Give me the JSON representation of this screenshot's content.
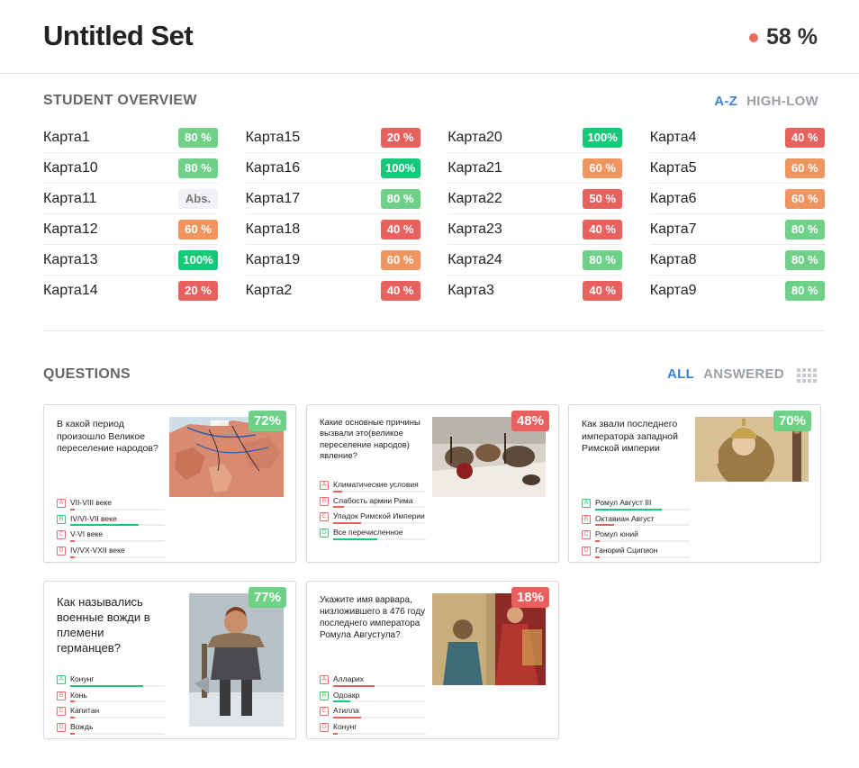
{
  "header": {
    "title": "Untitled Set",
    "overall_score": "58 %",
    "score_color": "#e96a5f"
  },
  "overview": {
    "title": "STUDENT OVERVIEW",
    "sort_az": "A-Z",
    "sort_high_low": "HIGH-LOW"
  },
  "colors": {
    "green": "#6fd088",
    "bright_green": "#16c97a",
    "orange": "#f0955f",
    "red": "#e9615f",
    "abs": "#f1f2f6"
  },
  "students": [
    [
      {
        "name": "Карта1",
        "score": "80 %",
        "color": "#6fd088"
      },
      {
        "name": "Карта10",
        "score": "80 %",
        "color": "#6fd088"
      },
      {
        "name": "Карта11",
        "score": "Abs.",
        "color": "abs"
      },
      {
        "name": "Карта12",
        "score": "60 %",
        "color": "#f0955f"
      },
      {
        "name": "Карта13",
        "score": "100%",
        "color": "#16c97a"
      },
      {
        "name": "Карта14",
        "score": "20 %",
        "color": "#e9615f"
      }
    ],
    [
      {
        "name": "Карта15",
        "score": "20 %",
        "color": "#e9615f"
      },
      {
        "name": "Карта16",
        "score": "100%",
        "color": "#16c97a"
      },
      {
        "name": "Карта17",
        "score": "80 %",
        "color": "#6fd088"
      },
      {
        "name": "Карта18",
        "score": "40 %",
        "color": "#e9615f"
      },
      {
        "name": "Карта19",
        "score": "60 %",
        "color": "#f0955f"
      },
      {
        "name": "Карта2",
        "score": "40 %",
        "color": "#e9615f"
      }
    ],
    [
      {
        "name": "Карта20",
        "score": "100%",
        "color": "#16c97a"
      },
      {
        "name": "Карта21",
        "score": "60 %",
        "color": "#f0955f"
      },
      {
        "name": "Карта22",
        "score": "50 %",
        "color": "#e9615f"
      },
      {
        "name": "Карта23",
        "score": "40 %",
        "color": "#e9615f"
      },
      {
        "name": "Карта24",
        "score": "80 %",
        "color": "#6fd088"
      },
      {
        "name": "Карта3",
        "score": "40 %",
        "color": "#e9615f"
      }
    ],
    [
      {
        "name": "Карта4",
        "score": "40 %",
        "color": "#e9615f"
      },
      {
        "name": "Карта5",
        "score": "60 %",
        "color": "#f0955f"
      },
      {
        "name": "Карта6",
        "score": "60 %",
        "color": "#f0955f"
      },
      {
        "name": "Карта7",
        "score": "80 %",
        "color": "#6fd088"
      },
      {
        "name": "Карта8",
        "score": "80 %",
        "color": "#6fd088"
      },
      {
        "name": "Карта9",
        "score": "80 %",
        "color": "#6fd088"
      }
    ]
  ],
  "questions_section": {
    "title": "QUESTIONS",
    "filter_all": "ALL",
    "filter_answered": "ANSWERED",
    "view_icon": "grid-view-icon"
  },
  "questions": [
    {
      "text": "В какой период произошло Великое переселение народов?",
      "percent": "72%",
      "percent_color": "#6fd088",
      "image": "europe-migration-map",
      "answers": [
        {
          "letter": "A",
          "text": "VII-VIII веке",
          "correct": false,
          "share": 0.05
        },
        {
          "letter": "B",
          "text": "IV/VI-VII веке",
          "correct": true,
          "share": 0.72
        },
        {
          "letter": "C",
          "text": "V-VI веке",
          "correct": false,
          "share": 0.05
        },
        {
          "letter": "D",
          "text": "IV/VX-VXII веке",
          "correct": false,
          "share": 0.05
        }
      ]
    },
    {
      "text": "Какие основные причины вызвали это(великое переселение народов) явление?",
      "percent": "48%",
      "percent_color": "#e9615f",
      "image": "barbarian-army-painting",
      "answers": [
        {
          "letter": "A",
          "text": "Климатические условия",
          "correct": false,
          "share": 0.1
        },
        {
          "letter": "B",
          "text": "Слабость армии Рима",
          "correct": false,
          "share": 0.12
        },
        {
          "letter": "C",
          "text": "Упадок Римской Империи",
          "correct": false,
          "share": 0.3
        },
        {
          "letter": "D",
          "text": "Все перечисленное",
          "correct": true,
          "share": 0.48
        }
      ]
    },
    {
      "text": "Как звали последнего императора западной Римской империи",
      "percent": "70%",
      "percent_color": "#6fd088",
      "image": "young-emperor-portrait",
      "answers": [
        {
          "letter": "A",
          "text": "Ромул Август III",
          "correct": true,
          "share": 0.7
        },
        {
          "letter": "B",
          "text": "Октавиан Август",
          "correct": false,
          "share": 0.2
        },
        {
          "letter": "C",
          "text": "Ромул юний",
          "correct": false,
          "share": 0.05
        },
        {
          "letter": "D",
          "text": "Ганорий Сципион",
          "correct": false,
          "share": 0.05
        }
      ]
    },
    {
      "text": "Как назывались военные вожди в племени германцев?",
      "percent": "77%",
      "percent_color": "#6fd088",
      "image": "germanic-warrior-art",
      "answers": [
        {
          "letter": "A",
          "text": "Конунг",
          "correct": true,
          "share": 0.77
        },
        {
          "letter": "B",
          "text": "Конь",
          "correct": false,
          "share": 0.05
        },
        {
          "letter": "C",
          "text": "Капитан",
          "correct": false,
          "share": 0.05
        },
        {
          "letter": "D",
          "text": "Вождь",
          "correct": false,
          "share": 0.05
        }
      ]
    },
    {
      "text": "Укажите имя варвара, низложившего в 476 году последнего императора Ромула Августула?",
      "percent": "18%",
      "percent_color": "#e9615f",
      "image": "odoacer-painting",
      "answers": [
        {
          "letter": "A",
          "text": "Алларих",
          "correct": false,
          "share": 0.45
        },
        {
          "letter": "B",
          "text": "Одоакр",
          "correct": true,
          "share": 0.18
        },
        {
          "letter": "C",
          "text": "Атилла",
          "correct": false,
          "share": 0.3
        },
        {
          "letter": "D",
          "text": "Конунг",
          "correct": false,
          "share": 0.05
        }
      ]
    }
  ]
}
